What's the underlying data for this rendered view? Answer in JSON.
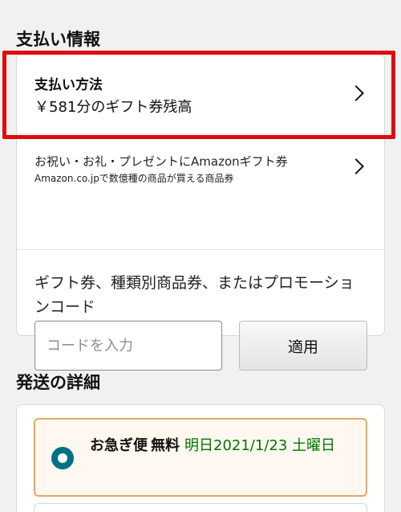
{
  "payment": {
    "section_title": "支払い情報",
    "method_label": "支払い方法",
    "method_value": "￥581分のギフト券残高",
    "gift_line1": "お祝い・お礼・プレゼントにAmazonギフト券",
    "gift_line2": "Amazon.co.jpで数億種の商品が買える商品券",
    "promo_text": "ギフト券、種類別商品券、またはプロモーションコード",
    "code_placeholder": "コードを入力",
    "apply_label": "適用"
  },
  "shipping": {
    "section_title": "発送の詳細",
    "option_name": "お急ぎ便",
    "option_price": "無料",
    "option_date": "明日2021/1/23 土曜日"
  },
  "colors": {
    "highlight": "#e00a0a",
    "radio": "#007185",
    "date_green": "#007600",
    "option_border": "#e3a95e"
  },
  "icons": {
    "chevron": "chevron-right-icon",
    "radio": "radio-selected-icon"
  }
}
